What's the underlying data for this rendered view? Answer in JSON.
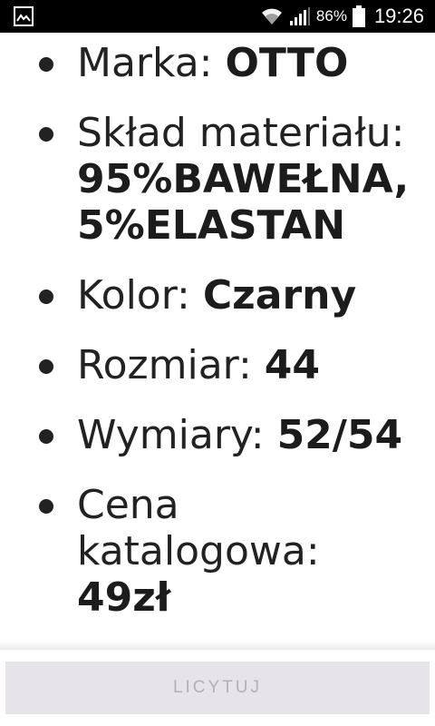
{
  "status_bar": {
    "left_icon": "image-icon",
    "wifi_icon": "wifi-icon",
    "signal_icon": "signal-icon",
    "battery_percent": "86%",
    "battery_icon": "battery-icon",
    "time": "19:26"
  },
  "specs": [
    {
      "label": "Marka: ",
      "value": "OTTO"
    },
    {
      "label": "Skład materiału: ",
      "value": "95%BAWEŁNA, 5%ELASTAN"
    },
    {
      "label": "Kolor: ",
      "value": "Czarny"
    },
    {
      "label": "Rozmiar: ",
      "value": "44"
    },
    {
      "label": "Wymiary: ",
      "value": "52/54"
    },
    {
      "label": "Cena katalogowa: ",
      "value": "49zł"
    }
  ],
  "action": {
    "bid_label": "LICYTUJ",
    "state": "disabled"
  }
}
